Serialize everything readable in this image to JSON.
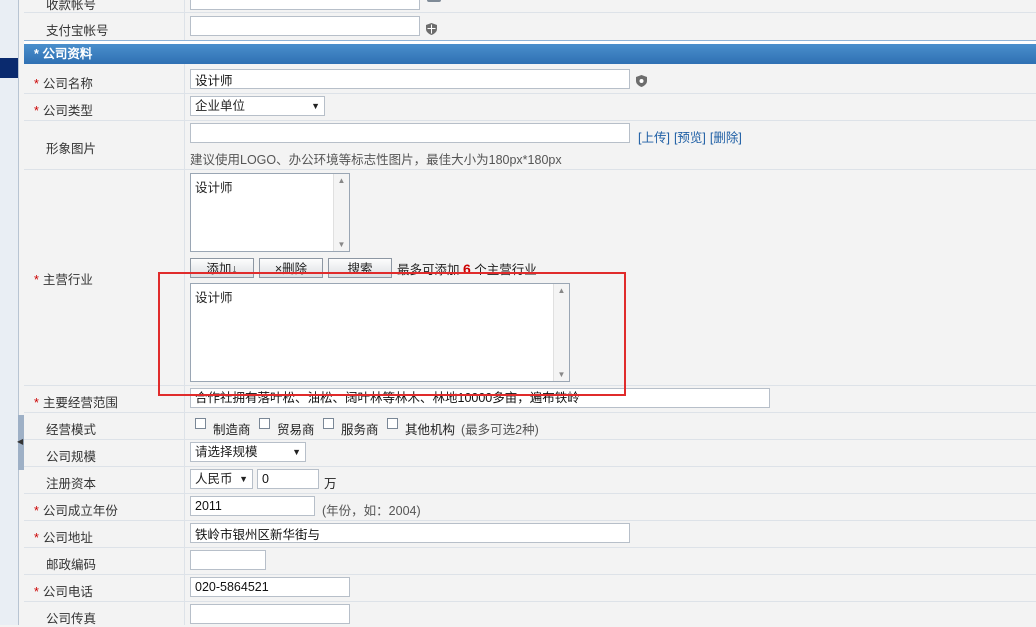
{
  "form": {
    "top_rows": [
      {
        "label": "收款帐号",
        "value": ""
      },
      {
        "label": "支付宝帐号",
        "value": ""
      }
    ],
    "section_title": "* 公司资料",
    "company_name": {
      "label": "公司名称",
      "value": "设计师"
    },
    "company_type": {
      "label": "公司类型",
      "value": "企业单位"
    },
    "image": {
      "label": "形象图片",
      "value": "",
      "links": [
        "[上传]",
        "[预览]",
        "[删除]"
      ],
      "hint": "建议使用LOGO、办公环境等标志性图片，最佳大小为180px*180px"
    },
    "industry": {
      "label": "主营行业",
      "list_text": "设计师",
      "btn_add": "添加↓",
      "btn_delete": "×删除",
      "btn_search": "搜索",
      "limit_prefix": "最多可添加",
      "limit_num": "6",
      "limit_suffix": "个主营行业",
      "overlay_text": "设计师"
    },
    "scope": {
      "label": "主要经营范围",
      "value": "合作社拥有落叶松、油松、阔叶林等林木、林地10000多亩，遍布铁岭"
    },
    "mode": {
      "label": "经营模式",
      "options": [
        "制造商",
        "贸易商",
        "服务商",
        "其他机构"
      ],
      "hint": "(最多可选2种)"
    },
    "scale": {
      "label": "公司规模",
      "value": "请选择规模"
    },
    "capital": {
      "label": "注册资本",
      "currency": "人民币",
      "amount": "0",
      "unit": "万"
    },
    "founded": {
      "label": "公司成立年份",
      "value": "2011",
      "hint": "(年份，如：2004)"
    },
    "address": {
      "label": "公司地址",
      "value": "铁岭市银州区新华街与"
    },
    "postcode": {
      "label": "邮政编码",
      "value": ""
    },
    "phone": {
      "label": "公司电话",
      "value": "020-5864521"
    },
    "fax": {
      "label": "公司传真",
      "value": ""
    }
  },
  "colors": {
    "section": "#3a7fc0",
    "required": "#cc0000",
    "highlight": "#e02b2b",
    "link": "#1f5fa5"
  }
}
